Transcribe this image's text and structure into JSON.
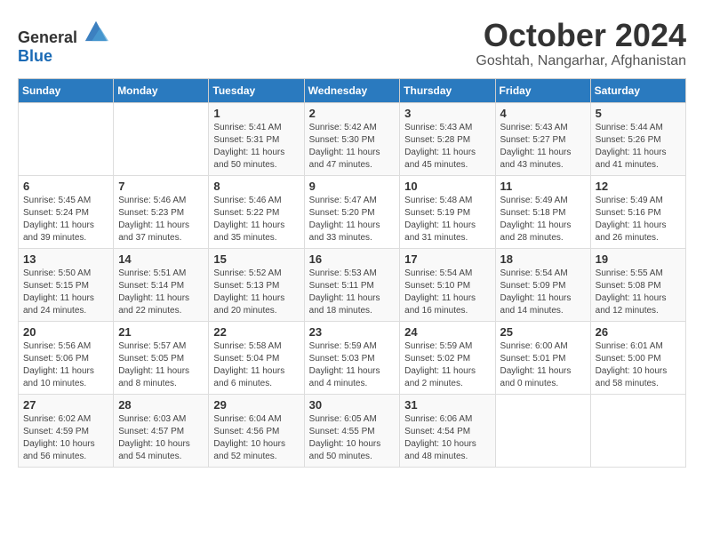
{
  "header": {
    "logo_general": "General",
    "logo_blue": "Blue",
    "month": "October 2024",
    "location": "Goshtah, Nangarhar, Afghanistan"
  },
  "calendar": {
    "days_of_week": [
      "Sunday",
      "Monday",
      "Tuesday",
      "Wednesday",
      "Thursday",
      "Friday",
      "Saturday"
    ],
    "weeks": [
      [
        {
          "day": "",
          "detail": ""
        },
        {
          "day": "",
          "detail": ""
        },
        {
          "day": "1",
          "detail": "Sunrise: 5:41 AM\nSunset: 5:31 PM\nDaylight: 11 hours and 50 minutes."
        },
        {
          "day": "2",
          "detail": "Sunrise: 5:42 AM\nSunset: 5:30 PM\nDaylight: 11 hours and 47 minutes."
        },
        {
          "day": "3",
          "detail": "Sunrise: 5:43 AM\nSunset: 5:28 PM\nDaylight: 11 hours and 45 minutes."
        },
        {
          "day": "4",
          "detail": "Sunrise: 5:43 AM\nSunset: 5:27 PM\nDaylight: 11 hours and 43 minutes."
        },
        {
          "day": "5",
          "detail": "Sunrise: 5:44 AM\nSunset: 5:26 PM\nDaylight: 11 hours and 41 minutes."
        }
      ],
      [
        {
          "day": "6",
          "detail": "Sunrise: 5:45 AM\nSunset: 5:24 PM\nDaylight: 11 hours and 39 minutes."
        },
        {
          "day": "7",
          "detail": "Sunrise: 5:46 AM\nSunset: 5:23 PM\nDaylight: 11 hours and 37 minutes."
        },
        {
          "day": "8",
          "detail": "Sunrise: 5:46 AM\nSunset: 5:22 PM\nDaylight: 11 hours and 35 minutes."
        },
        {
          "day": "9",
          "detail": "Sunrise: 5:47 AM\nSunset: 5:20 PM\nDaylight: 11 hours and 33 minutes."
        },
        {
          "day": "10",
          "detail": "Sunrise: 5:48 AM\nSunset: 5:19 PM\nDaylight: 11 hours and 31 minutes."
        },
        {
          "day": "11",
          "detail": "Sunrise: 5:49 AM\nSunset: 5:18 PM\nDaylight: 11 hours and 28 minutes."
        },
        {
          "day": "12",
          "detail": "Sunrise: 5:49 AM\nSunset: 5:16 PM\nDaylight: 11 hours and 26 minutes."
        }
      ],
      [
        {
          "day": "13",
          "detail": "Sunrise: 5:50 AM\nSunset: 5:15 PM\nDaylight: 11 hours and 24 minutes."
        },
        {
          "day": "14",
          "detail": "Sunrise: 5:51 AM\nSunset: 5:14 PM\nDaylight: 11 hours and 22 minutes."
        },
        {
          "day": "15",
          "detail": "Sunrise: 5:52 AM\nSunset: 5:13 PM\nDaylight: 11 hours and 20 minutes."
        },
        {
          "day": "16",
          "detail": "Sunrise: 5:53 AM\nSunset: 5:11 PM\nDaylight: 11 hours and 18 minutes."
        },
        {
          "day": "17",
          "detail": "Sunrise: 5:54 AM\nSunset: 5:10 PM\nDaylight: 11 hours and 16 minutes."
        },
        {
          "day": "18",
          "detail": "Sunrise: 5:54 AM\nSunset: 5:09 PM\nDaylight: 11 hours and 14 minutes."
        },
        {
          "day": "19",
          "detail": "Sunrise: 5:55 AM\nSunset: 5:08 PM\nDaylight: 11 hours and 12 minutes."
        }
      ],
      [
        {
          "day": "20",
          "detail": "Sunrise: 5:56 AM\nSunset: 5:06 PM\nDaylight: 11 hours and 10 minutes."
        },
        {
          "day": "21",
          "detail": "Sunrise: 5:57 AM\nSunset: 5:05 PM\nDaylight: 11 hours and 8 minutes."
        },
        {
          "day": "22",
          "detail": "Sunrise: 5:58 AM\nSunset: 5:04 PM\nDaylight: 11 hours and 6 minutes."
        },
        {
          "day": "23",
          "detail": "Sunrise: 5:59 AM\nSunset: 5:03 PM\nDaylight: 11 hours and 4 minutes."
        },
        {
          "day": "24",
          "detail": "Sunrise: 5:59 AM\nSunset: 5:02 PM\nDaylight: 11 hours and 2 minutes."
        },
        {
          "day": "25",
          "detail": "Sunrise: 6:00 AM\nSunset: 5:01 PM\nDaylight: 11 hours and 0 minutes."
        },
        {
          "day": "26",
          "detail": "Sunrise: 6:01 AM\nSunset: 5:00 PM\nDaylight: 10 hours and 58 minutes."
        }
      ],
      [
        {
          "day": "27",
          "detail": "Sunrise: 6:02 AM\nSunset: 4:59 PM\nDaylight: 10 hours and 56 minutes."
        },
        {
          "day": "28",
          "detail": "Sunrise: 6:03 AM\nSunset: 4:57 PM\nDaylight: 10 hours and 54 minutes."
        },
        {
          "day": "29",
          "detail": "Sunrise: 6:04 AM\nSunset: 4:56 PM\nDaylight: 10 hours and 52 minutes."
        },
        {
          "day": "30",
          "detail": "Sunrise: 6:05 AM\nSunset: 4:55 PM\nDaylight: 10 hours and 50 minutes."
        },
        {
          "day": "31",
          "detail": "Sunrise: 6:06 AM\nSunset: 4:54 PM\nDaylight: 10 hours and 48 minutes."
        },
        {
          "day": "",
          "detail": ""
        },
        {
          "day": "",
          "detail": ""
        }
      ]
    ]
  }
}
